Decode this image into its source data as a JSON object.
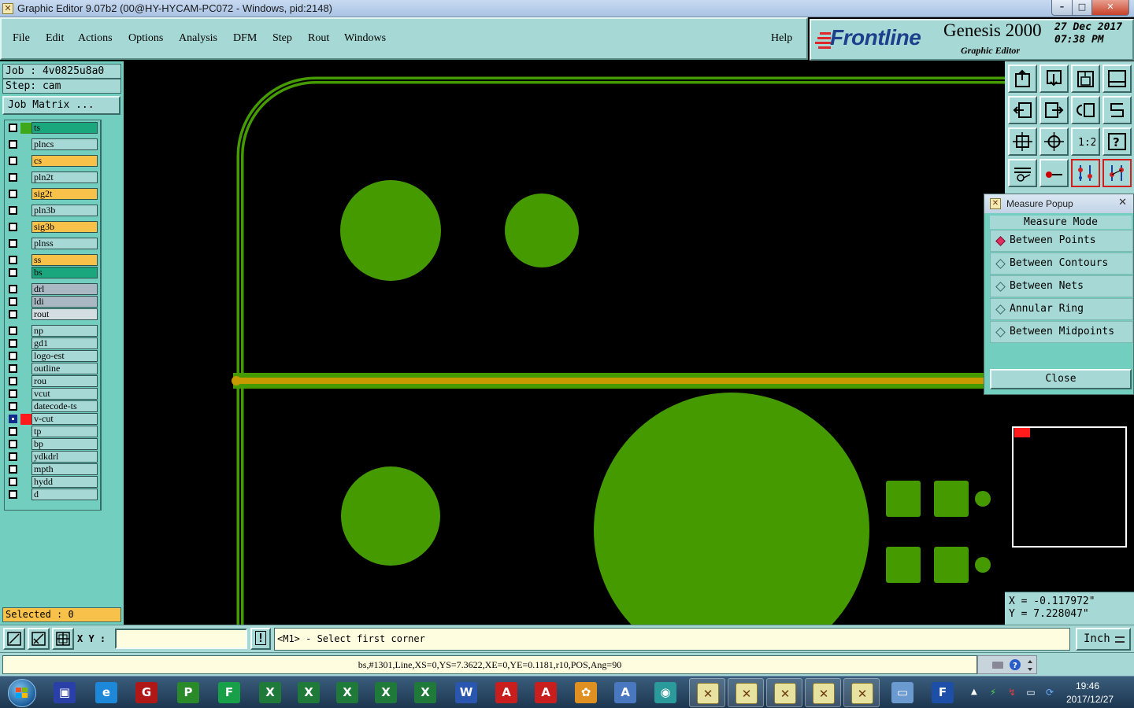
{
  "window": {
    "title": "Graphic Editor 9.07b2 (00@HY-HYCAM-PC072 - Windows, pid:2148)",
    "min_glyph": "–",
    "max_glyph": "□",
    "close_glyph": "✕"
  },
  "menu": {
    "items": [
      "File",
      "Edit",
      "Actions",
      "Options",
      "Analysis",
      "DFM",
      "Step",
      "Rout",
      "Windows"
    ],
    "help": "Help"
  },
  "brand": {
    "logo": "Frontline",
    "product": "Genesis 2000",
    "subtitle": "Graphic Editor",
    "date": "27 Dec 2017",
    "time": "07:38 PM",
    "logo_color": "#1d3f8c",
    "logo_accent": "#e0262a"
  },
  "job": {
    "job_label": "Job : 4v0825u8a0",
    "step_label": "Step: cam",
    "matrix_button": "Job Matrix ..."
  },
  "layers": [
    {
      "name": "ts",
      "color": "#1aa77e",
      "swatch": "#3da81a"
    },
    {
      "name": "plncs",
      "color": "#a6d9d5"
    },
    {
      "name": "cs",
      "color": "#f8c24a"
    },
    {
      "name": "pln2t",
      "color": "#a6d9d5"
    },
    {
      "name": "sig2t",
      "color": "#f8c24a"
    },
    {
      "name": "pln3b",
      "color": "#a6d9d5"
    },
    {
      "name": "sig3b",
      "color": "#f8c24a"
    },
    {
      "name": "plnss",
      "color": "#a6d9d5"
    },
    {
      "name": "ss",
      "color": "#f8c24a"
    },
    {
      "name": "bs",
      "color": "#1aa77e"
    },
    {
      "name": "drl",
      "color": "#a9b8c2"
    },
    {
      "name": "ldi",
      "color": "#a9b8c2"
    },
    {
      "name": "rout",
      "color": "#d4dde2"
    },
    {
      "name": "np",
      "color": "#a6d9d5"
    },
    {
      "name": "gd1",
      "color": "#a6d9d5"
    },
    {
      "name": "logo-est",
      "color": "#a6d9d5"
    },
    {
      "name": "outline",
      "color": "#a6d9d5"
    },
    {
      "name": "rou",
      "color": "#a6d9d5"
    },
    {
      "name": "vcut",
      "color": "#a6d9d5"
    },
    {
      "name": "datecode-ts",
      "color": "#a6d9d5"
    },
    {
      "name": "v-cut",
      "color": "#a6d9d5",
      "swatch": "#ff1b1b",
      "checked": true
    },
    {
      "name": "tp",
      "color": "#a6d9d5"
    },
    {
      "name": "bp",
      "color": "#a6d9d5"
    },
    {
      "name": "ydkdrl",
      "color": "#a6d9d5"
    },
    {
      "name": "mpth",
      "color": "#a6d9d5"
    },
    {
      "name": "hydd",
      "color": "#a6d9d5"
    },
    {
      "name": "d",
      "color": "#a6d9d5"
    }
  ],
  "selected": "Selected : 0",
  "measure": {
    "title": "Measure Popup",
    "mode_label": "Measure Mode",
    "options": [
      "Between Points",
      "Between Contours",
      "Between Nets",
      "Annular Ring",
      "Between Midpoints"
    ],
    "active": 0,
    "close_label": "Close",
    "close_glyph": "✕"
  },
  "coords": {
    "x": "X = -0.117972\"",
    "y": "Y = 7.228047\""
  },
  "cmd": {
    "xy_label": "X Y :",
    "xy_value": "",
    "warn": "!",
    "prompt": "<M1> - Select first corner",
    "unit": "Inch"
  },
  "status": "bs,#1301,Line,XS=0,YS=7.3622,XE=0,YE=0.1181,r10,POS,Ang=90",
  "colors": {
    "panel": "#a6d9d5",
    "panel_dark": "#72cebf",
    "feature_green": "#459a00",
    "vcut_yellow": "#c69a00"
  },
  "taskbar": {
    "icons": [
      "floppy-icon",
      "ie-icon",
      "genesis-g-icon",
      "p-icon",
      "f-icon",
      "excel-icon",
      "excel-icon",
      "excel-icon",
      "excel-icon",
      "excel-icon",
      "word-icon",
      "pdf-icon",
      "pdf-icon",
      "shell-icon",
      "text-doc-icon",
      "eye-icon",
      "genesis-window-icon",
      "genesis-window-icon",
      "genesis-window-icon",
      "genesis-window-icon",
      "genesis-window-icon",
      "screen-icon",
      "frontline-icon"
    ],
    "time": "19:46",
    "date": "2017/12/27"
  }
}
